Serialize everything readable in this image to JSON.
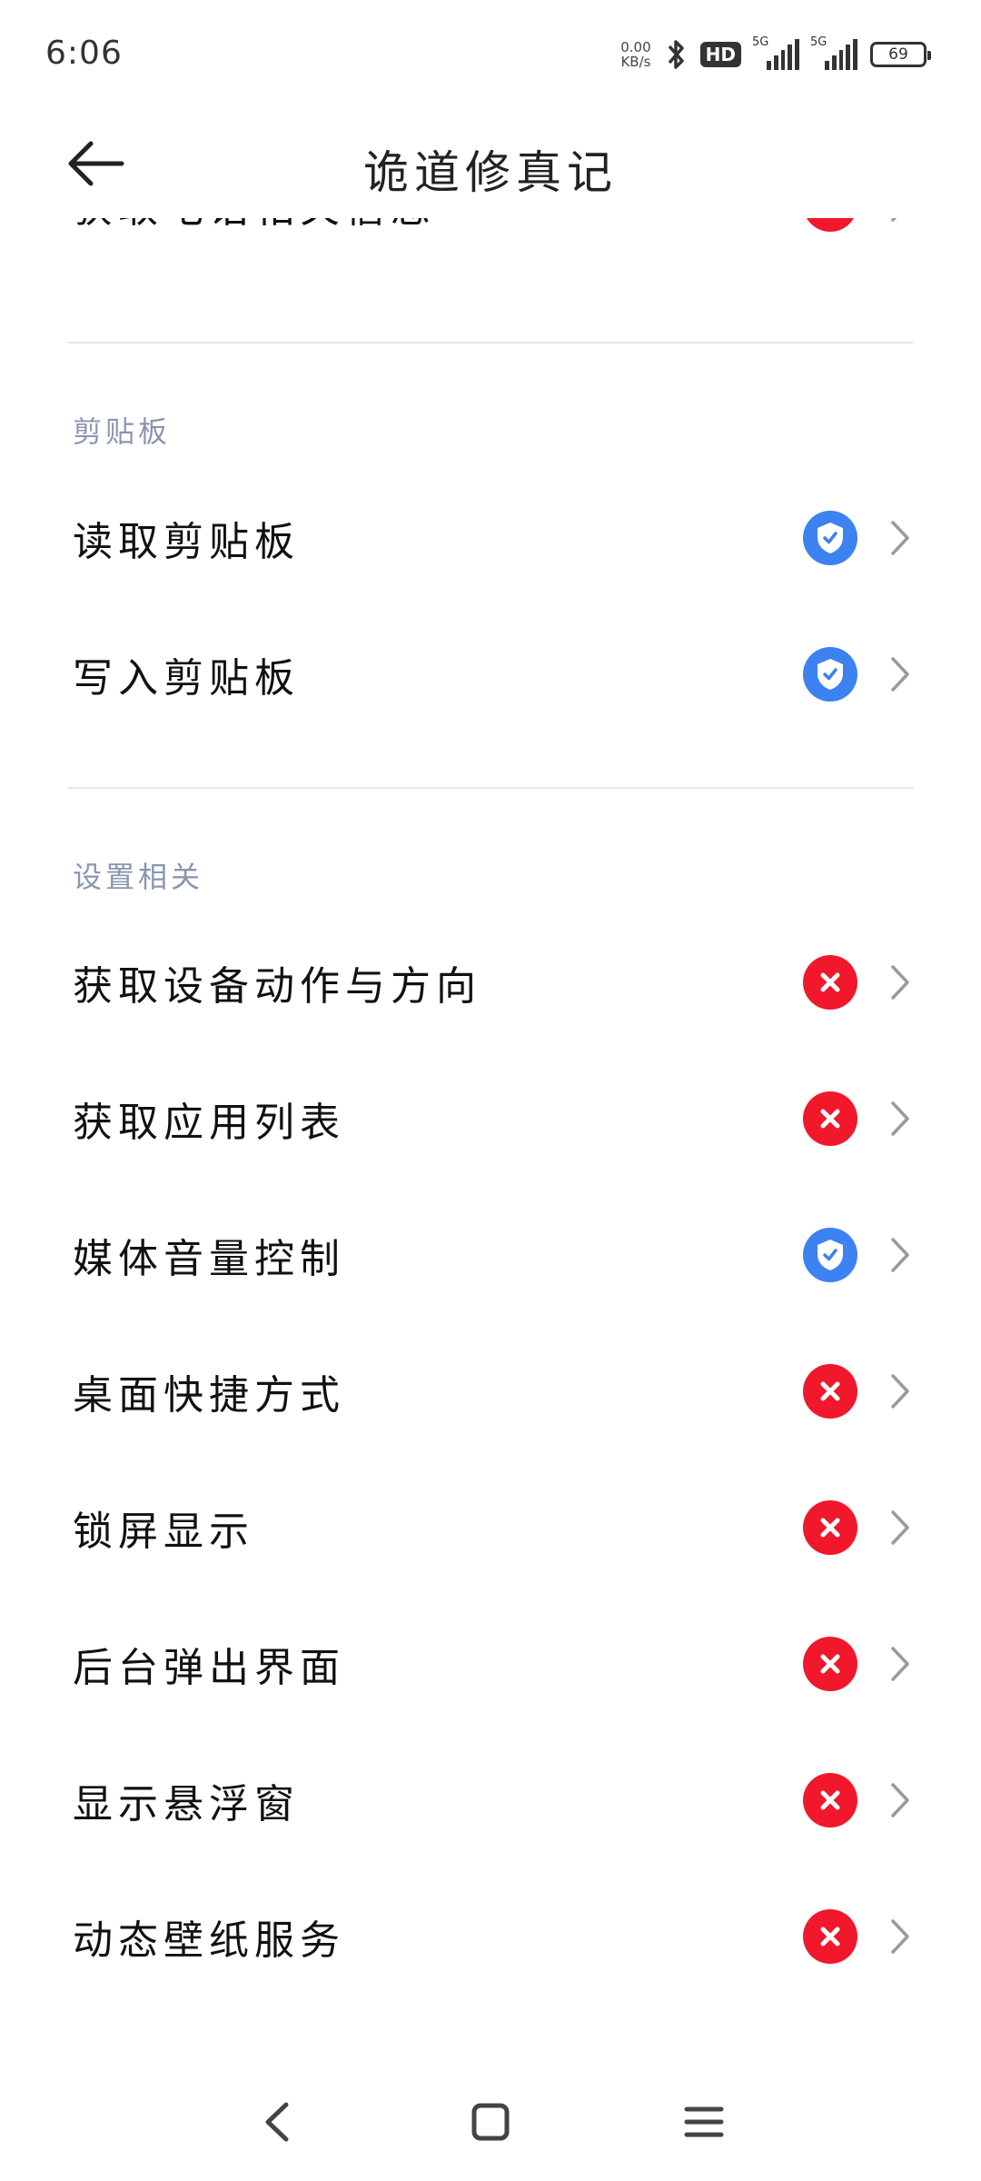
{
  "status_bar": {
    "time": "6:06",
    "net_speed_value": "0.00",
    "net_speed_unit": "KB/s",
    "hd_label": "HD",
    "signal_1_label": "5G",
    "signal_2_label": "5G",
    "battery_level": "69"
  },
  "header": {
    "back_icon": "arrow-left-icon",
    "title": "诡道修真记"
  },
  "partial_top_row": {
    "label": "获取电话相关信息",
    "status": "deny"
  },
  "sections": [
    {
      "title": "剪贴板",
      "items": [
        {
          "label": "读取剪贴板",
          "status": "allow"
        },
        {
          "label": "写入剪贴板",
          "status": "allow"
        }
      ]
    },
    {
      "title": "设置相关",
      "items": [
        {
          "label": "获取设备动作与方向",
          "status": "deny"
        },
        {
          "label": "获取应用列表",
          "status": "deny"
        },
        {
          "label": "媒体音量控制",
          "status": "allow"
        },
        {
          "label": "桌面快捷方式",
          "status": "deny"
        },
        {
          "label": "锁屏显示",
          "status": "deny"
        },
        {
          "label": "后台弹出界面",
          "status": "deny"
        },
        {
          "label": "显示悬浮窗",
          "status": "deny"
        },
        {
          "label": "动态壁纸服务",
          "status": "deny"
        }
      ]
    }
  ],
  "colors": {
    "deny": "#f0182a",
    "allow": "#3c82f0",
    "section_title": "#8a95b0"
  },
  "navbar": {
    "back_icon": "triangle-back-icon",
    "home_icon": "square-home-icon",
    "menu_icon": "menu-lines-icon"
  }
}
